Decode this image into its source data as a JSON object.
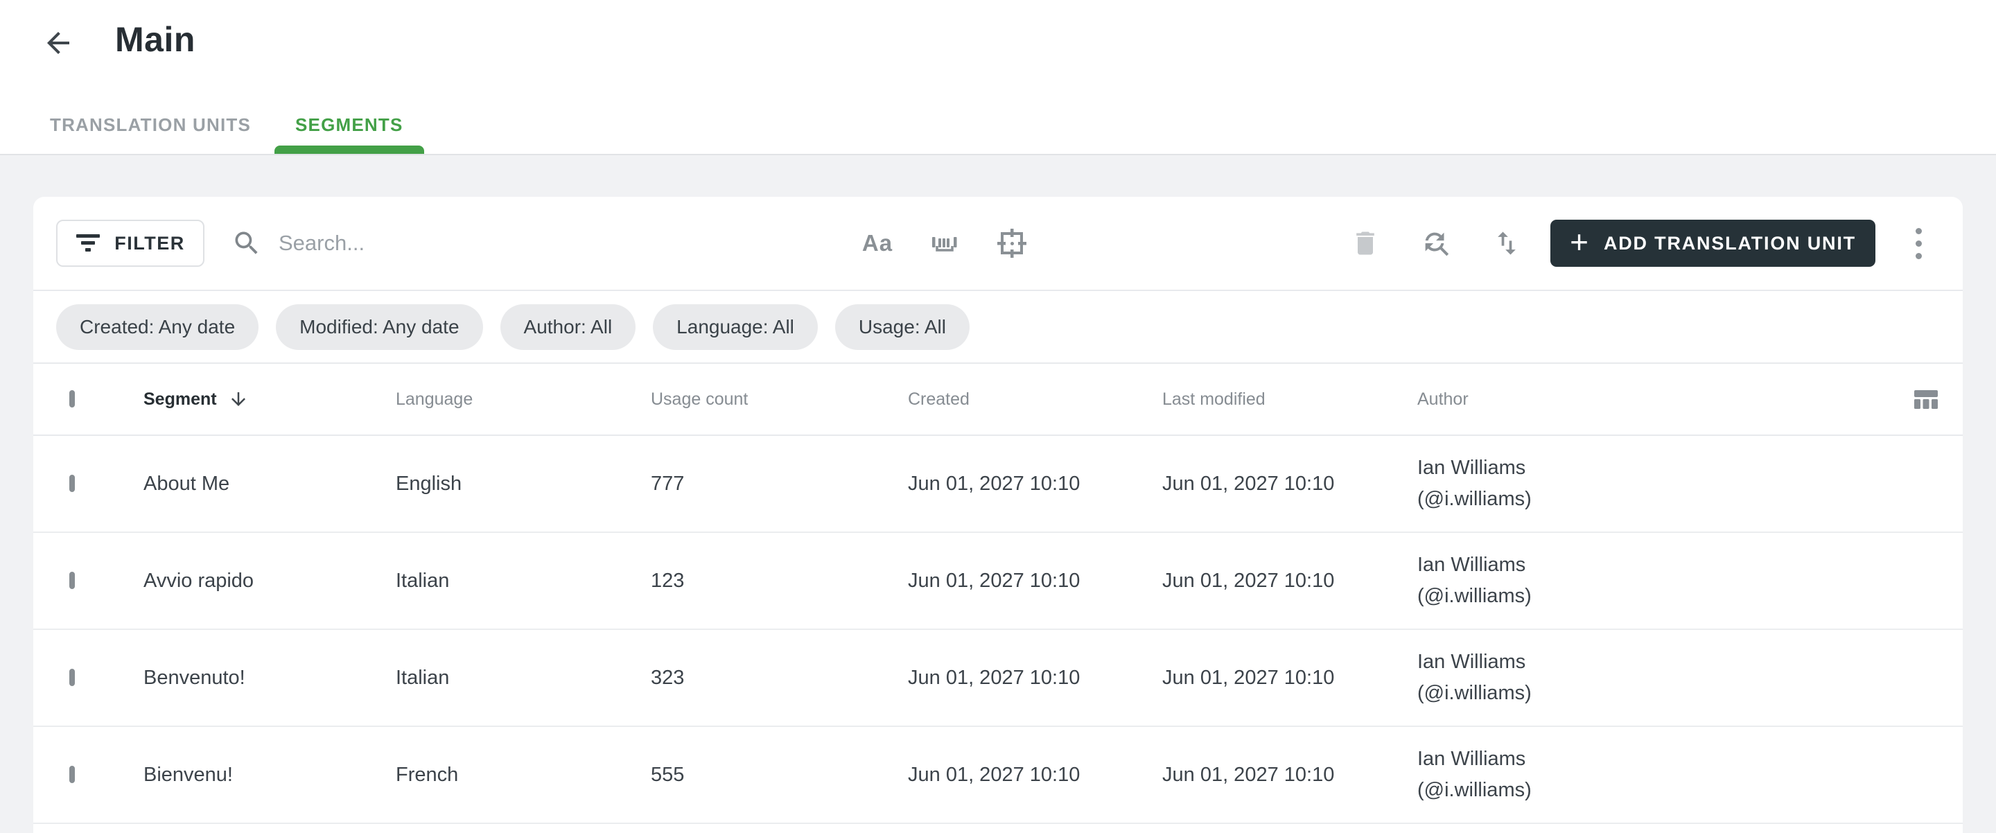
{
  "header": {
    "title": "Main"
  },
  "tabs": {
    "translation_units": "TRANSLATION UNITS",
    "segments": "SEGMENTS"
  },
  "toolbar": {
    "filter_label": "FILTER",
    "search_placeholder": "Search...",
    "match_case_glyph": "Aa",
    "plus_glyph": "+",
    "add_button_label": "ADD TRANSLATION UNIT"
  },
  "filter_chips": [
    "Created: Any date",
    "Modified: Any date",
    "Author: All",
    "Language: All",
    "Usage: All"
  ],
  "table": {
    "columns": [
      "Segment",
      "Language",
      "Usage count",
      "Created",
      "Last modified",
      "Author"
    ],
    "rows": [
      {
        "segment": "About Me",
        "language": "English",
        "usage_count": "777",
        "created": "Jun 01, 2027 10:10",
        "last_modified": "Jun 01, 2027 10:10",
        "author_name": "Ian Williams",
        "author_handle": "(@i.williams)"
      },
      {
        "segment": "Avvio rapido",
        "language": "Italian",
        "usage_count": "123",
        "created": "Jun 01, 2027 10:10",
        "last_modified": "Jun 01, 2027 10:10",
        "author_name": "Ian Williams",
        "author_handle": "(@i.williams)"
      },
      {
        "segment": "Benvenuto!",
        "language": "Italian",
        "usage_count": "323",
        "created": "Jun 01, 2027 10:10",
        "last_modified": "Jun 01, 2027 10:10",
        "author_name": "Ian Williams",
        "author_handle": "(@i.williams)"
      },
      {
        "segment": "Bienvenu!",
        "language": "French",
        "usage_count": "555",
        "created": "Jun 01, 2027 10:10",
        "last_modified": "Jun 01, 2027 10:10",
        "author_name": "Ian Williams",
        "author_handle": "(@i.williams)"
      }
    ]
  },
  "colors": {
    "accent_green": "#43a047",
    "dark_button": "#263238",
    "page_background": "#f1f2f4"
  }
}
